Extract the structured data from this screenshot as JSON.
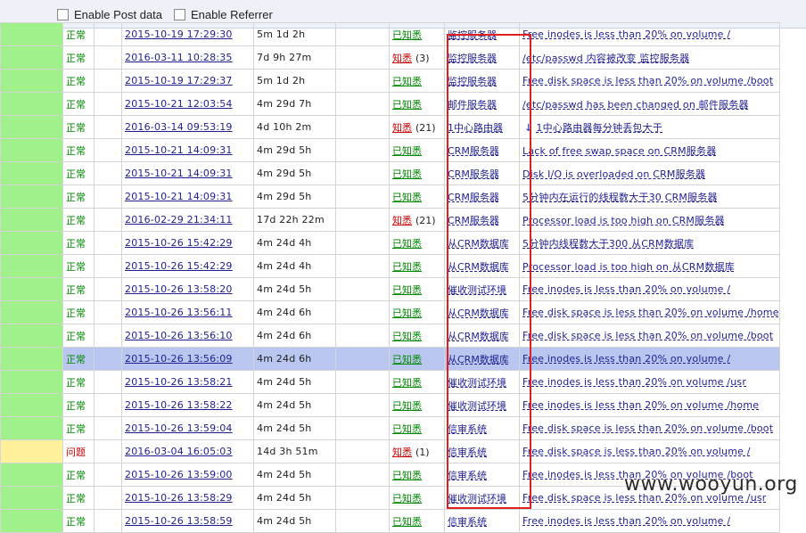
{
  "toolbar": {
    "enable_post_data": "Enable Post data",
    "enable_referrer": "Enable Referrer"
  },
  "watermark": "www.wooyun.org",
  "rows": [
    {
      "status": "正常",
      "time": "2015-10-19 17:29:30",
      "age": "5m 1d 2h",
      "ack": "已知悉",
      "ack_count": "",
      "host": "监控服务器",
      "desc": "Free inodes is less than 20% on volume /",
      "state": "ok"
    },
    {
      "status": "正常",
      "time": "2016-03-11 10:28:35",
      "age": "7d 9h 27m",
      "ack": "知悉",
      "ack_count": "(3)",
      "host": "监控服务器",
      "desc": "/etc/passwd 内容被改变 监控服务器",
      "state": "ok"
    },
    {
      "status": "正常",
      "time": "2015-10-19 17:29:37",
      "age": "5m 1d 2h",
      "ack": "已知悉",
      "ack_count": "",
      "host": "监控服务器",
      "desc": "Free disk space is less than 20% on volume /boot",
      "state": "ok"
    },
    {
      "status": "正常",
      "time": "2015-10-21 12:03:54",
      "age": "4m 29d 7h",
      "ack": "已知悉",
      "ack_count": "",
      "host": "邮件服务器",
      "desc": "/etc/passwd has been changed on 邮件服务器",
      "state": "ok"
    },
    {
      "status": "正常",
      "time": "2016-03-14 09:53:19",
      "age": "4d 10h 2m",
      "ack": "知悉",
      "ack_count": "(21)",
      "host": "1中心路由器",
      "desc": "1中心路由器每分钟丢包大于",
      "state": "ok",
      "arrow": true
    },
    {
      "status": "正常",
      "time": "2015-10-21 14:09:31",
      "age": "4m 29d 5h",
      "ack": "已知悉",
      "ack_count": "",
      "host": "CRM服务器",
      "desc": "Lack of free swap space on CRM服务器",
      "state": "ok"
    },
    {
      "status": "正常",
      "time": "2015-10-21 14:09:31",
      "age": "4m 29d 5h",
      "ack": "已知悉",
      "ack_count": "",
      "host": "CRM服务器",
      "desc": "Disk I/O is overloaded on CRM服务器",
      "state": "ok"
    },
    {
      "status": "正常",
      "time": "2015-10-21 14:09:31",
      "age": "4m 29d 5h",
      "ack": "已知悉",
      "ack_count": "",
      "host": "CRM服务器",
      "desc": "5分钟内在运行的线程数大于30 CRM服务器",
      "state": "ok"
    },
    {
      "status": "正常",
      "time": "2016-02-29 21:34:11",
      "age": "17d 22h 22m",
      "ack": "知悉",
      "ack_count": "(21)",
      "host": "CRM服务器",
      "desc": "Processor load is too high on CRM服务器",
      "state": "ok"
    },
    {
      "status": "正常",
      "time": "2015-10-26 15:42:29",
      "age": "4m 24d 4h",
      "ack": "已知悉",
      "ack_count": "",
      "host": "从CRM数据库",
      "desc": "5分钟内线程数大于300 从CRM数据库",
      "state": "ok"
    },
    {
      "status": "正常",
      "time": "2015-10-26 15:42:29",
      "age": "4m 24d 4h",
      "ack": "已知悉",
      "ack_count": "",
      "host": "从CRM数据库",
      "desc": "Processor load is too high on 从CRM数据库",
      "state": "ok"
    },
    {
      "status": "正常",
      "time": "2015-10-26 13:58:20",
      "age": "4m 24d 5h",
      "ack": "已知悉",
      "ack_count": "",
      "host": "催收测试环境",
      "desc": "Free inodes is less than 20% on volume /",
      "state": "ok"
    },
    {
      "status": "正常",
      "time": "2015-10-26 13:56:11",
      "age": "4m 24d 6h",
      "ack": "已知悉",
      "ack_count": "",
      "host": "从CRM数据库",
      "desc": "Free disk space is less than 20% on volume /home",
      "state": "ok"
    },
    {
      "status": "正常",
      "time": "2015-10-26 13:56:10",
      "age": "4m 24d 6h",
      "ack": "已知悉",
      "ack_count": "",
      "host": "从CRM数据库",
      "desc": "Free disk space is less than 20% on volume /boot",
      "state": "ok"
    },
    {
      "status": "正常",
      "time": "2015-10-26 13:56:09",
      "age": "4m 24d 6h",
      "ack": "已知悉",
      "ack_count": "",
      "host": "从CRM数据库",
      "desc": "Free inodes is less than 20% on volume /",
      "state": "selected"
    },
    {
      "status": "正常",
      "time": "2015-10-26 13:58:21",
      "age": "4m 24d 5h",
      "ack": "已知悉",
      "ack_count": "",
      "host": "催收测试环境",
      "desc": "Free inodes is less than 20% on volume /usr",
      "state": "ok"
    },
    {
      "status": "正常",
      "time": "2015-10-26 13:58:22",
      "age": "4m 24d 5h",
      "ack": "已知悉",
      "ack_count": "",
      "host": "催收测试环境",
      "desc": "Free inodes is less than 20% on volume /home",
      "state": "ok"
    },
    {
      "status": "正常",
      "time": "2015-10-26 13:59:04",
      "age": "4m 24d 5h",
      "ack": "已知悉",
      "ack_count": "",
      "host": "信审系统",
      "desc": "Free disk space is less than 20% on volume /boot",
      "state": "ok"
    },
    {
      "status": "问题",
      "time": "2016-03-04 16:05:03",
      "age": "14d 3h 51m",
      "ack": "知悉",
      "ack_count": "(1)",
      "host": "信审系统",
      "desc": "Free disk space is less than 20% on volume /",
      "state": "problem"
    },
    {
      "status": "正常",
      "time": "2015-10-26 13:59:00",
      "age": "4m 24d 5h",
      "ack": "已知悉",
      "ack_count": "",
      "host": "信审系统",
      "desc": "Free inodes is less than 20% on volume /boot",
      "state": "ok"
    },
    {
      "status": "正常",
      "time": "2015-10-26 13:58:29",
      "age": "4m 24d 5h",
      "ack": "已知悉",
      "ack_count": "",
      "host": "催收测试环境",
      "desc": "Free disk space is less than 20% on volume /usr",
      "state": "ok"
    },
    {
      "status": "正常",
      "time": "2015-10-26 13:58:59",
      "age": "4m 24d 5h",
      "ack": "已知悉",
      "ack_count": "",
      "host": "信审系统",
      "desc": "Free inodes is less than 20% on volume /",
      "state": "ok"
    }
  ],
  "colors": {
    "severity_ok": "#a0f08c",
    "severity_problem": "#fff09c",
    "status_ok": "#008800",
    "status_problem": "#cc0000",
    "selected_row": "#b9c7f0",
    "highlight_box": "#e02020",
    "link": "#1f1f8f"
  }
}
